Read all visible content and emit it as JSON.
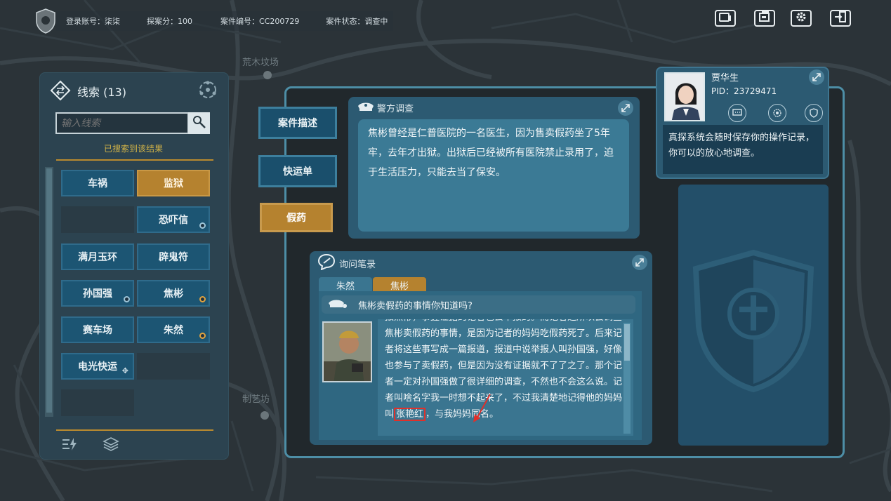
{
  "header": {
    "account": "登录账号：柒柒",
    "score": "探案分：100",
    "case_no": "案件编号：CC200729",
    "status": "案件状态：调查中"
  },
  "top_buttons": [
    {
      "name": "tablet-button",
      "icon": "tablet-icon"
    },
    {
      "name": "document-button",
      "icon": "document-icon"
    },
    {
      "name": "settings-button",
      "icon": "gear-icon"
    },
    {
      "name": "exit-button",
      "icon": "exit-icon"
    }
  ],
  "map_labels": [
    "荒木坟场",
    "制艺坊"
  ],
  "clues": {
    "title": "线索 (13)",
    "search_placeholder": "输入线索",
    "search_result": "已搜索到该结果",
    "items": [
      {
        "label": "车祸",
        "style": "normal",
        "dot": ""
      },
      {
        "label": "监狱",
        "style": "gold",
        "dot": ""
      },
      {
        "label": "",
        "style": "empty",
        "dot": ""
      },
      {
        "label": "恐吓信",
        "style": "normal",
        "dot": "blue"
      },
      {
        "label": "满月玉环",
        "style": "normal",
        "dot": ""
      },
      {
        "label": "辟鬼符",
        "style": "normal",
        "dot": ""
      },
      {
        "label": "孙国强",
        "style": "normal",
        "dot": "blue"
      },
      {
        "label": "焦彬",
        "style": "normal",
        "dot": "orange"
      },
      {
        "label": "赛车场",
        "style": "normal",
        "dot": ""
      },
      {
        "label": "朱然",
        "style": "normal",
        "dot": "orange"
      },
      {
        "label": "电光快运",
        "style": "normal",
        "dot": "cursor"
      },
      {
        "label": "",
        "style": "empty",
        "dot": ""
      },
      {
        "label": "",
        "style": "empty",
        "dot": ""
      }
    ]
  },
  "tabs": [
    {
      "label": "案件描述",
      "active": false
    },
    {
      "label": "快运单",
      "active": false
    },
    {
      "label": "假药",
      "active": true
    }
  ],
  "police": {
    "title": "警方调查",
    "text": "焦彬曾经是仁普医院的一名医生，因为售卖假药坐了5年牢，去年才出狱。出狱后已经被所有医院禁止录用了，迫于生活压力，只能去当了保安。"
  },
  "inquiry": {
    "title": "询问笔录",
    "tabs": [
      {
        "label": "朱然",
        "active": false
      },
      {
        "label": "焦彬",
        "active": true
      }
    ],
    "question": "焦彬卖假药的事情你知道吗?",
    "answer_before": "报照彬，事握证据的记者也去举报的。而记者之所以会调查焦彬卖假药的事情，是因为记者的妈妈吃假药死了。后来记者将这些事写成一篇报道，报道中说举报人叫孙国强，好像也参与了卖假药，但是因为没有证据就不了了之了。那个记者一定对孙国强做了很详细的调查，不然也不会这么说。记者叫啥名字我一时想不起来了，不过我清楚地记得他的妈妈叫",
    "answer_highlight": "张艳红",
    "answer_after": "，与我妈妈同名。"
  },
  "profile": {
    "name": "贾华生",
    "pid": "PID：23729471",
    "message": "真探系统会随时保存你的操作记录，你可以的放心地调查。"
  },
  "colors": {
    "accent_gold": "#b5822f",
    "panel_blue": "#1c5573",
    "frame_blue": "#4d8ea6",
    "highlight_red": "#e0302a"
  }
}
